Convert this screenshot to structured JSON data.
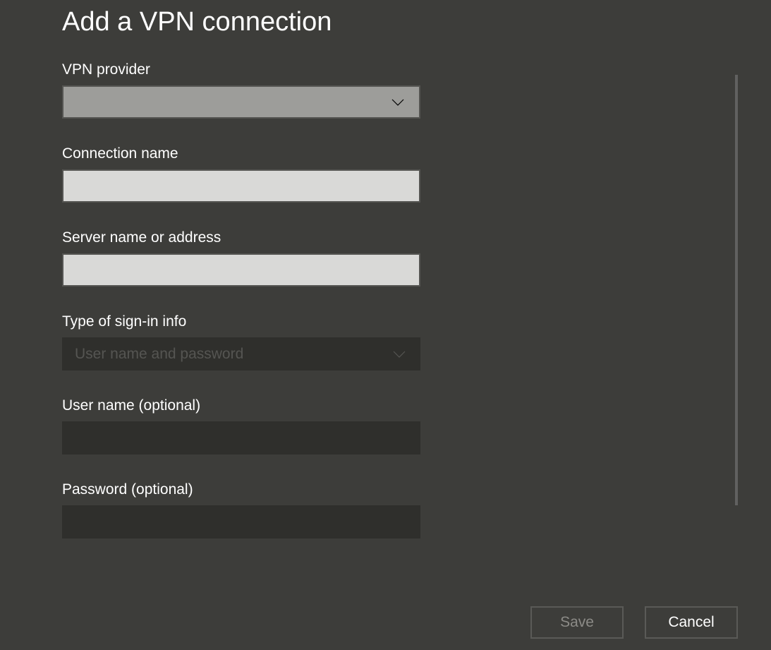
{
  "title": "Add a VPN connection",
  "fields": {
    "vpn_provider": {
      "label": "VPN provider",
      "selected": ""
    },
    "connection_name": {
      "label": "Connection name",
      "value": ""
    },
    "server_address": {
      "label": "Server name or address",
      "value": ""
    },
    "signin_type": {
      "label": "Type of sign-in info",
      "selected": "User name and password"
    },
    "username": {
      "label": "User name (optional)",
      "value": ""
    },
    "password": {
      "label": "Password (optional)",
      "value": ""
    }
  },
  "buttons": {
    "save": "Save",
    "cancel": "Cancel"
  }
}
